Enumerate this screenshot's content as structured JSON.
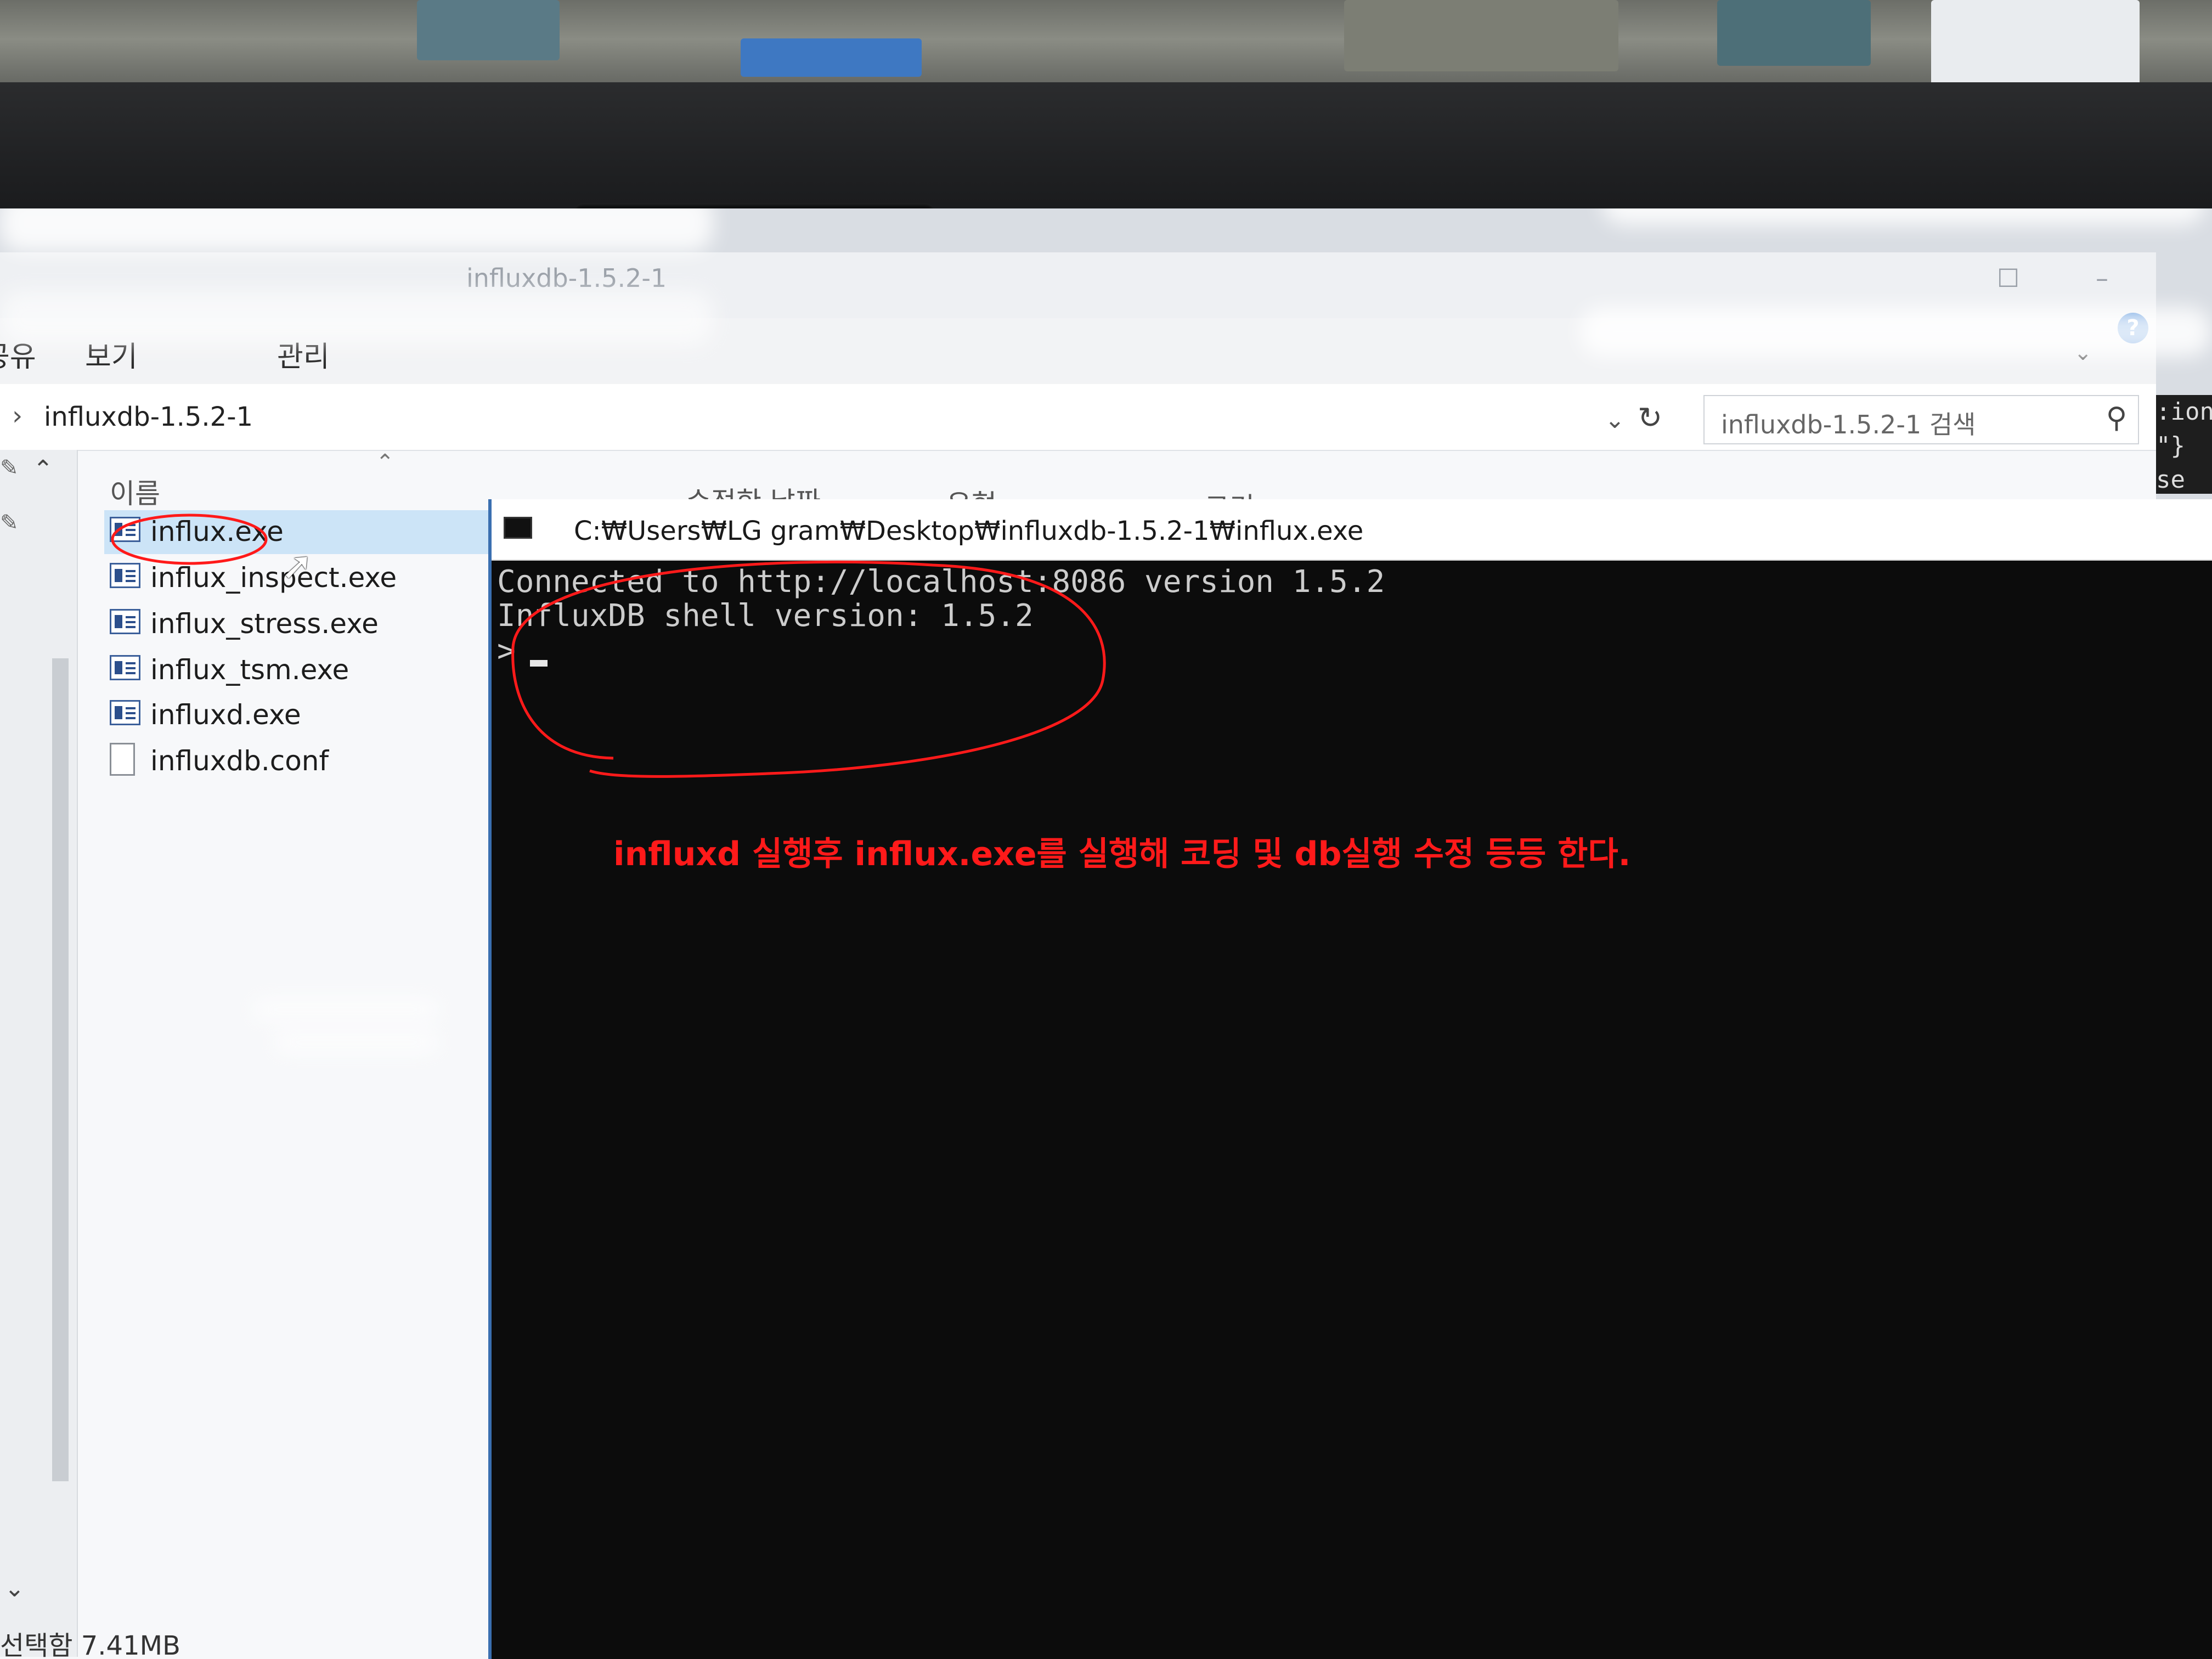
{
  "explorer": {
    "window_title": "influxdb-1.5.2-1",
    "ribbon_tabs": [
      "공유",
      "보기",
      "관리"
    ],
    "breadcrumb": "influxdb-1.5.2-1",
    "search_placeholder": "influxdb-1.5.2-1 검색",
    "help_label": "?",
    "columns": {
      "name": "이름",
      "date": "수정한 날짜",
      "type": "유형",
      "size": "크기"
    },
    "files": [
      {
        "name": "influx.exe",
        "icon": "exe-icon",
        "selected": true
      },
      {
        "name": "influx_inspect.exe",
        "icon": "exe-icon",
        "selected": false
      },
      {
        "name": "influx_stress.exe",
        "icon": "exe-icon",
        "selected": false
      },
      {
        "name": "influx_tsm.exe",
        "icon": "exe-icon",
        "selected": false
      },
      {
        "name": "influxd.exe",
        "icon": "exe-icon",
        "selected": false
      },
      {
        "name": "influxdb.conf",
        "icon": "document-icon",
        "selected": false
      }
    ],
    "status": "선택함 7.41MB"
  },
  "console": {
    "title": "C:₩Users₩LG gram₩Desktop₩influxdb-1.5.2-1₩influx.exe",
    "lines": [
      "Connected to http://localhost:8086 version 1.5.2",
      "InfluxDB shell version: 1.5.2",
      "> "
    ]
  },
  "annotation": {
    "text": "influxd 실행후 influx.exe를 실행해 코딩 및 db실행 수정 등등 한다.",
    "color": "#ff1a1a"
  },
  "side_editor": {
    "lines": [
      ":ion",
      "\"}",
      " se"
    ]
  }
}
